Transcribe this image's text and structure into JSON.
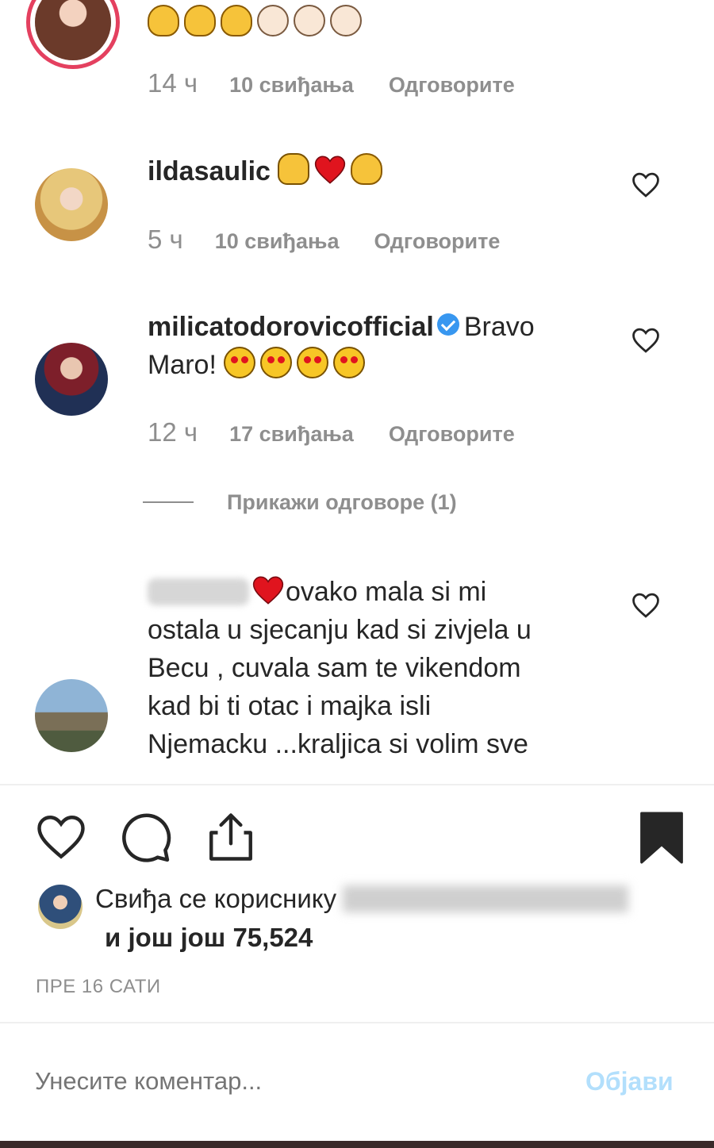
{
  "comments": [
    {
      "username": "",
      "text": "",
      "emojis": [
        "muscle-emoji",
        "muscle-emoji",
        "muscle-emoji",
        "clap-emoji",
        "clap-emoji",
        "clap-emoji"
      ],
      "time": "14 ч",
      "likes": "10 свиђања",
      "reply": "Одговорите"
    },
    {
      "username": "ildasaulic",
      "text": "",
      "emojis": [
        "hands-emoji",
        "heart-emoji",
        "muscle-emoji"
      ],
      "time": "5 ч",
      "likes": "10 свиђања",
      "reply": "Одговорите"
    },
    {
      "username": "milicatodorovicofficial",
      "text_line1": "Bravo",
      "text_line2": "Maro!",
      "emojis": [
        "heart-eyes-emoji",
        "heart-eyes-emoji",
        "heart-eyes-emoji",
        "heart-eyes-emoji"
      ],
      "time": "12 ч",
      "likes": "17 свиђања",
      "reply": "Одговорите"
    },
    {
      "lines": [
        "ovako mala si mi",
        "ostala u sjecanju kad si zivjela u",
        "Becu , cuvala sam te vikendom",
        "kad bi ti otac i majka isli",
        "Njemacku ...kraljica si volim sve"
      ]
    }
  ],
  "view_replies": "Прикажи одговоре (1)",
  "actions": {
    "like_icon": "heart-icon",
    "comment_icon": "comment-icon",
    "share_icon": "share-icon",
    "save_icon": "bookmark-icon"
  },
  "liked_by_prefix": "Свиђа се кориснику",
  "liked_by_more": "и још још 75,524",
  "timestamp": "ПРЕ 16 САТИ",
  "comment_input": {
    "placeholder": "Унесите коментар..."
  },
  "post_label": "Објави",
  "colors": {
    "link": "#3897f0",
    "muted": "#8e8e8e",
    "heart": "#ed4956",
    "post_disabled": "#b2dffc"
  }
}
